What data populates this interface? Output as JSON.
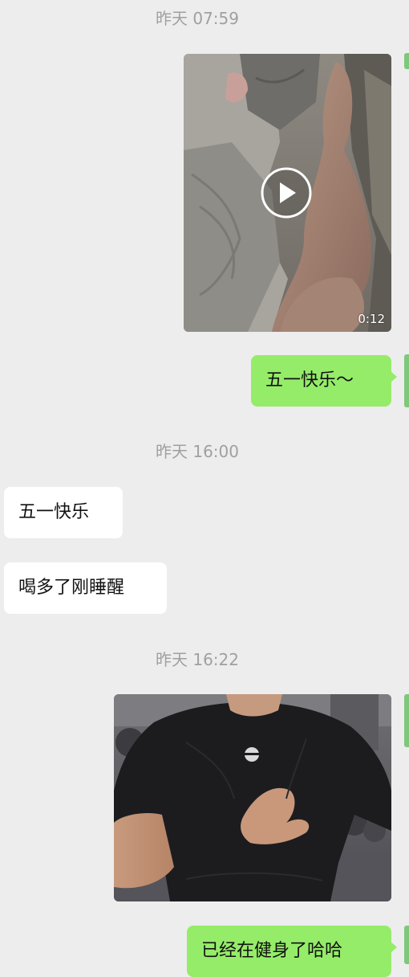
{
  "chat": {
    "messages": [
      {
        "type": "timestamp",
        "text": "昨天 07:59"
      },
      {
        "type": "video",
        "direction": "out",
        "duration": "0:12"
      },
      {
        "type": "text",
        "direction": "out",
        "text": "五一快乐～"
      },
      {
        "type": "timestamp",
        "text": "昨天 16:00"
      },
      {
        "type": "text",
        "direction": "in",
        "text": "五一快乐"
      },
      {
        "type": "text",
        "direction": "in",
        "text": "喝多了刚睡醒"
      },
      {
        "type": "timestamp",
        "text": "昨天 16:22"
      },
      {
        "type": "image",
        "direction": "out"
      },
      {
        "type": "text",
        "direction": "out",
        "text": "已经在健身了哈哈"
      }
    ]
  },
  "colors": {
    "background": "#ededed",
    "outgoing_bubble": "#95ec69",
    "incoming_bubble": "#ffffff",
    "timestamp_text": "#a0a0a0"
  },
  "icons": {
    "video_play": "play-circle-icon"
  }
}
